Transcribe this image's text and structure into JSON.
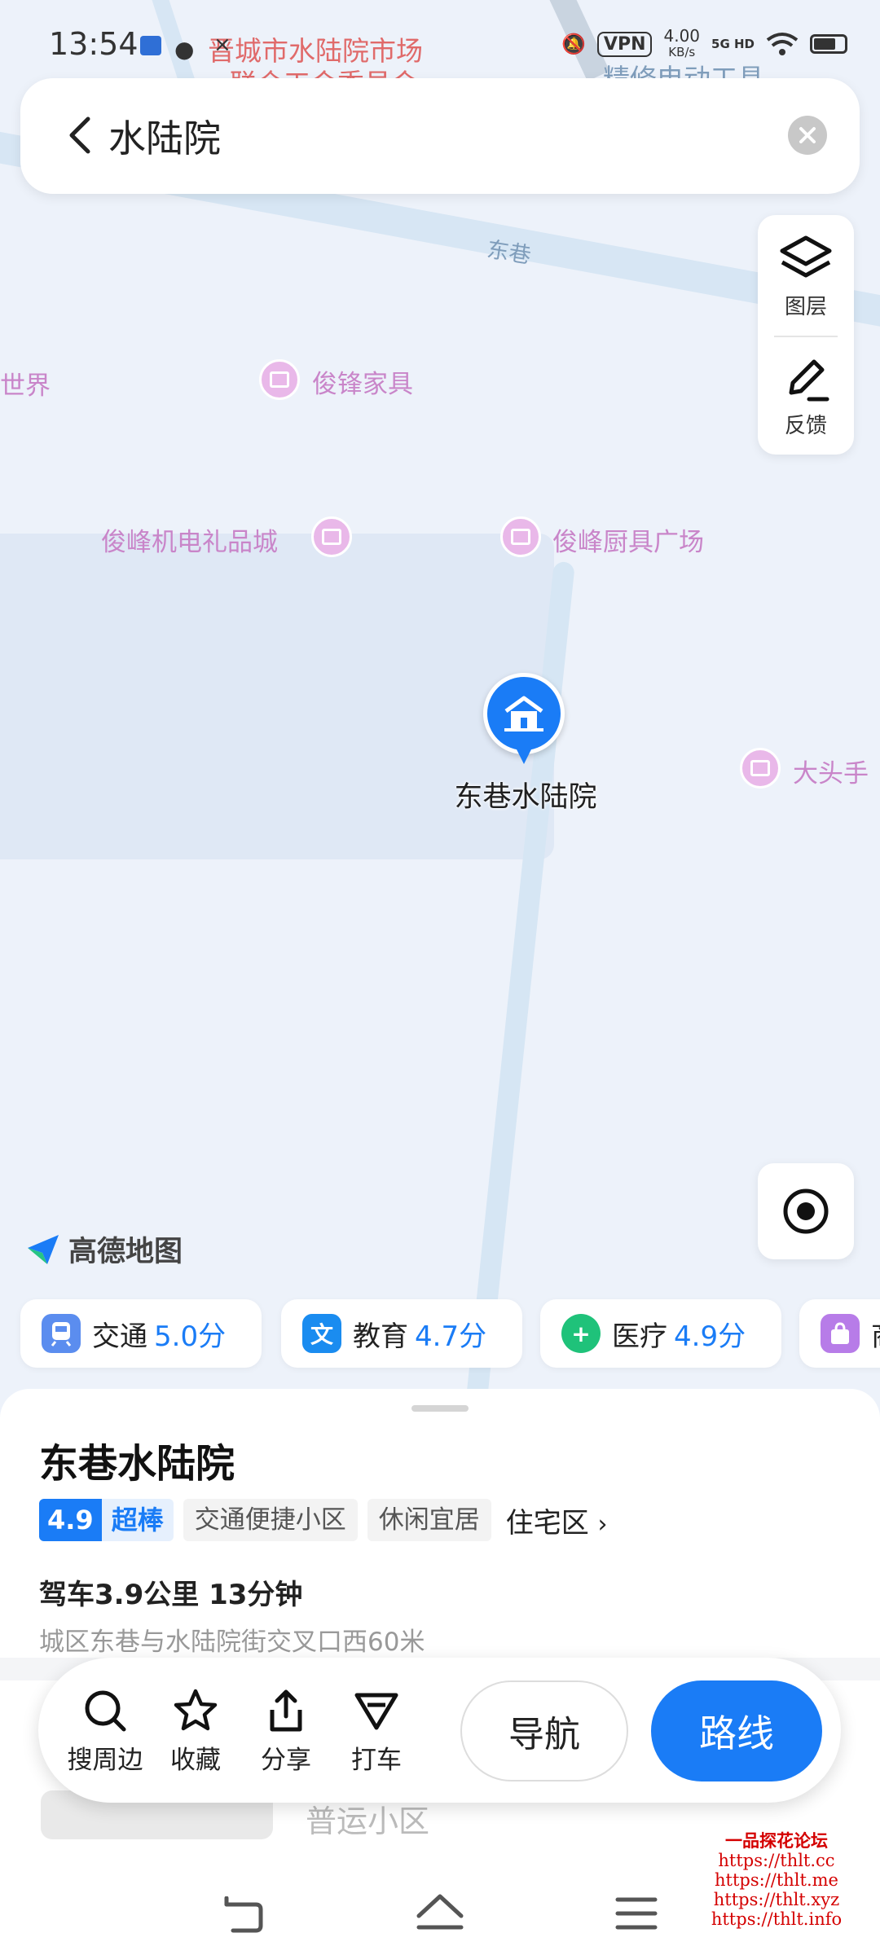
{
  "status_bar": {
    "time": "13:54",
    "vpn": "VPN",
    "speed": "4.00",
    "speed_unit": "KB/s",
    "network": "5G HD"
  },
  "map": {
    "top_labels": [
      "晋城市水陆院市场",
      "联合工会委员会",
      "精修电动工具"
    ],
    "road_label": "东巷",
    "pois": [
      {
        "name": "世界"
      },
      {
        "name": "俊锋家具"
      },
      {
        "name": "俊峰机电礼品城"
      },
      {
        "name": "俊峰厨具广场"
      },
      {
        "name": "大头手"
      }
    ],
    "marker_label": "东巷水陆院",
    "brand": "高德地图"
  },
  "search": {
    "query": "水陆院"
  },
  "tools": {
    "layers_label": "图层",
    "feedback_label": "反馈"
  },
  "chips": [
    {
      "label": "交通",
      "score": "5.0分",
      "icon_color": "#5b8def"
    },
    {
      "label": "教育",
      "score": "4.7分",
      "icon_text": "文",
      "icon_color": "#1a8cf0"
    },
    {
      "label": "医疗",
      "score": "4.9分",
      "icon_text": "+",
      "icon_color": "#1fc27a"
    },
    {
      "label": "商",
      "icon_color": "#b77ce8"
    }
  ],
  "place": {
    "title": "东巷水陆院",
    "score": "4.9",
    "score_text": "超棒",
    "tags": [
      "交通便捷小区",
      "休闲宜居"
    ],
    "category": "住宅区",
    "route_info": "驾车3.9公里 13分钟",
    "address": "城区东巷与水陆院街交叉口西60米",
    "below_item": "普运小区"
  },
  "actions": {
    "search_nearby": "搜周边",
    "favorite": "收藏",
    "share": "分享",
    "taxi": "打车",
    "navigate": "导航",
    "route": "路线"
  },
  "watermark": [
    "一品探花论坛",
    "https://thlt.cc",
    "https://thlt.me",
    "https://thlt.xyz",
    "https://thlt.info"
  ],
  "colors": {
    "accent": "#1a7cf6",
    "poi": "#c985c9"
  }
}
